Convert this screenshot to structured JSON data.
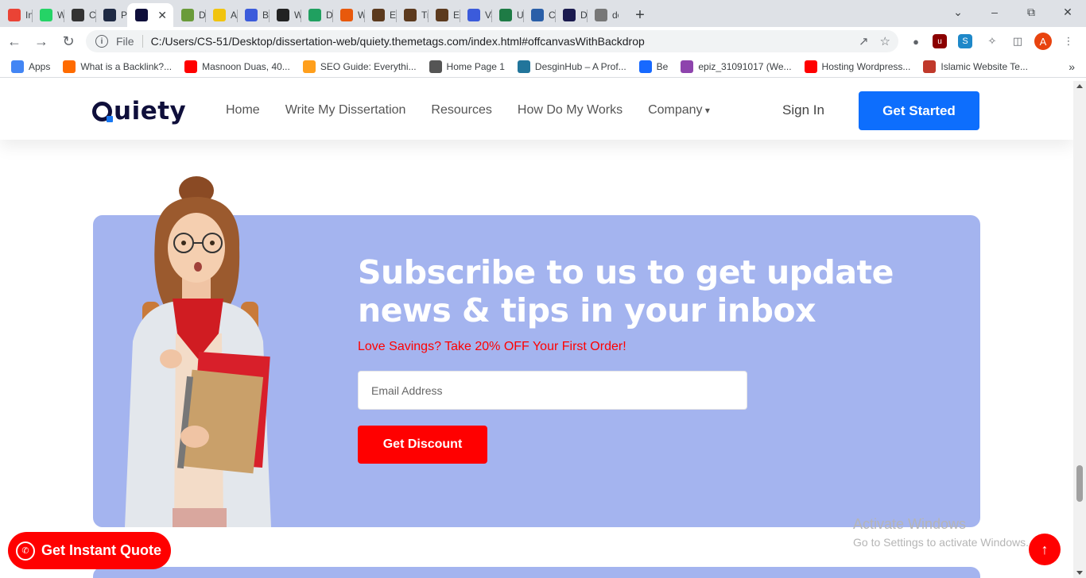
{
  "browser": {
    "tabs": [
      {
        "label": "Inb",
        "icon": "gmail-icon",
        "color": "#ea4335"
      },
      {
        "label": "Wh",
        "icon": "whatsapp-icon",
        "color": "#25d366"
      },
      {
        "label": "Cre",
        "icon": "trello-icon",
        "color": "#333333"
      },
      {
        "label": "Pay",
        "icon": "paypal-icon",
        "color": "#1f2a44"
      },
      {
        "label": "",
        "icon": "quiety-icon",
        "color": "#0f0f3b",
        "active": true
      },
      {
        "label": "Do",
        "icon": "doc-icon",
        "color": "#6a9b3a"
      },
      {
        "label": "Ass",
        "icon": "assignment-icon",
        "color": "#f1c40f"
      },
      {
        "label": "Buy",
        "icon": "buy-icon",
        "color": "#3b5bdb"
      },
      {
        "label": "Wr",
        "icon": "write-icon",
        "color": "#222222"
      },
      {
        "label": "Do",
        "icon": "paper-plane-icon",
        "color": "#20a060"
      },
      {
        "label": "Wr",
        "icon": "fire-icon",
        "color": "#e8590c"
      },
      {
        "label": "Eda",
        "icon": "book-icon",
        "color": "#5c3a1e"
      },
      {
        "label": "Tra",
        "icon": "book-icon",
        "color": "#5c3a1e"
      },
      {
        "label": "Est",
        "icon": "book-icon",
        "color": "#5c3a1e"
      },
      {
        "label": "Var",
        "icon": "wave-icon",
        "color": "#3b5bdb"
      },
      {
        "label": "UK",
        "icon": "uk-icon",
        "color": "#1e7b45"
      },
      {
        "label": "Cus",
        "icon": "bird-icon",
        "color": "#2a5fa8"
      },
      {
        "label": "Do",
        "icon": "circle-icon",
        "color": "#1a1a4e"
      },
      {
        "label": "dor",
        "icon": "globe-icon",
        "color": "#777777"
      }
    ],
    "new_tab": "+",
    "url_scheme": "File",
    "url": "C:/Users/CS-51/Desktop/dissertation-web/quiety.themetags.com/index.html#offcanvasWithBackdrop",
    "profile_initial": "A",
    "bookmarks": [
      {
        "label": "Apps",
        "icon": "apps-grid-icon",
        "color": "#4285f4"
      },
      {
        "label": "What is a Backlink?...",
        "icon": "backlink-icon",
        "color": "#ff6b00"
      },
      {
        "label": "Masnoon Duas, 40...",
        "icon": "youtube-icon",
        "color": "#ff0000"
      },
      {
        "label": "SEO Guide: Everythi...",
        "icon": "seo-icon",
        "color": "#ff9f1c"
      },
      {
        "label": "Home Page 1",
        "icon": "globe-icon",
        "color": "#555555"
      },
      {
        "label": "DesginHub – A Prof...",
        "icon": "wordpress-icon",
        "color": "#21759b"
      },
      {
        "label": "Be",
        "icon": "behance-icon",
        "color": "#1769ff"
      },
      {
        "label": "epiz_31091017 (We...",
        "icon": "infinity-icon",
        "color": "#8e44ad"
      },
      {
        "label": "Hosting Wordpress...",
        "icon": "youtube-icon",
        "color": "#ff0000"
      },
      {
        "label": "Islamic Website Te...",
        "icon": "elementor-icon",
        "color": "#c0392b"
      }
    ]
  },
  "site": {
    "logo": "uiety",
    "nav": [
      "Home",
      "Write My Dissertation",
      "Resources",
      "How Do My Works",
      "Company"
    ],
    "sign_in": "Sign In",
    "get_started": "Get Started"
  },
  "subscribe": {
    "title": "Subscribe to us to get update news & tips in your inbox",
    "offer": "Love Savings? Take 20% OFF Your First Order!",
    "email_placeholder": "Email Address",
    "button": "Get Discount",
    "bg_color": "#a4b4ef",
    "accent": "#ff0000"
  },
  "floating": {
    "quote": "Get Instant Quote",
    "to_top": "↑"
  },
  "watermark": {
    "line1": "Activate Windows",
    "line2": "Go to Settings to activate Windows."
  }
}
